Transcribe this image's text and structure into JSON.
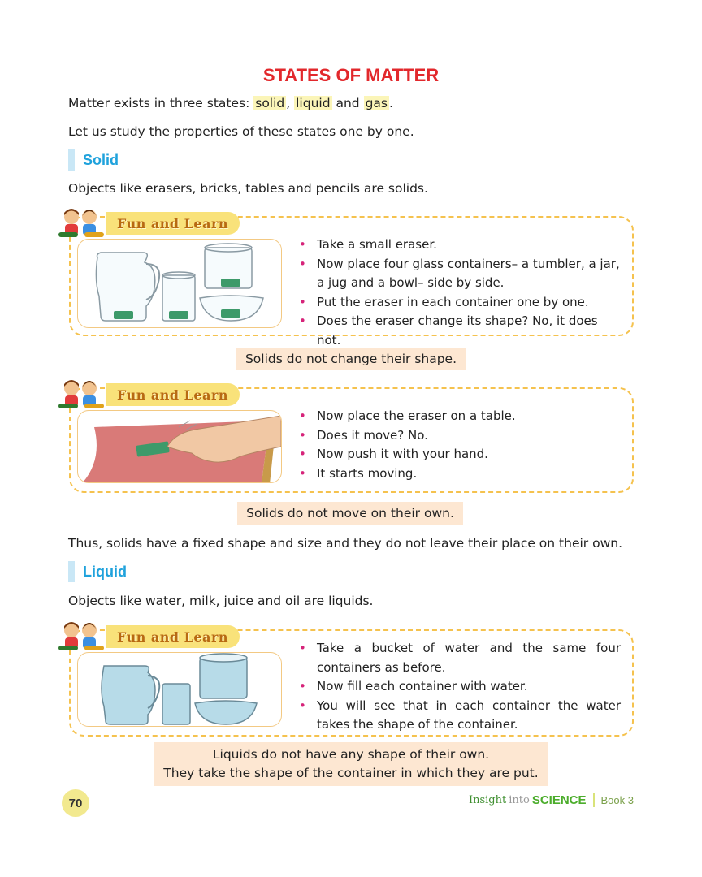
{
  "title": "STATES OF MATTER",
  "intro": {
    "pre": "Matter exists in three states: ",
    "solid": "solid",
    "comma": ", ",
    "liquid": "liquid",
    "and": " and ",
    "gas": "gas",
    "end": "."
  },
  "study_line": "Let us study the properties of these states one by one.",
  "solid": {
    "heading": "Solid",
    "examples": "Objects like erasers, bricks, tables and pencils are solids.",
    "activity1": {
      "tag": "Fun and Learn",
      "bullets": [
        "Take a small eraser.",
        "Now place four glass containers– a tumbler, a jar, a jug and a bowl– side by side.",
        "Put the eraser in each container one by one.",
        "Does the eraser change its shape? No, it does not."
      ],
      "note": "Solids do not change their shape."
    },
    "activity2": {
      "tag": "Fun and Learn",
      "bullets": [
        "Now place the eraser on a table.",
        "Does it move? No.",
        "Now push it with your hand.",
        "It starts moving."
      ],
      "note": "Solids do not move on their own."
    },
    "summary": "Thus, solids have a fixed shape and size and they do not leave their place on their own."
  },
  "liquid": {
    "heading": "Liquid",
    "examples": "Objects like water, milk, juice and oil are liquids.",
    "activity": {
      "tag": "Fun and Learn",
      "bullets": [
        "Take a bucket of water and the same four containers as before.",
        "Now fill each container with water.",
        "You will see that in each container the water takes the shape of the container."
      ],
      "note_lines": [
        "Liquids do not have any shape of their own.",
        "They take the shape of the container in which they are put."
      ]
    }
  },
  "footer": {
    "page_number": "70",
    "insight": "Insight",
    "into": "into",
    "science": "SCIENCE",
    "book": "Book 3"
  },
  "colors": {
    "title": "#e2282c",
    "section_heading": "#1fa2dc",
    "panel_border": "#f5c24e",
    "note_bg": "#fde7d2",
    "bullet": "#d6247a",
    "highlight": "#fbf5b8"
  }
}
